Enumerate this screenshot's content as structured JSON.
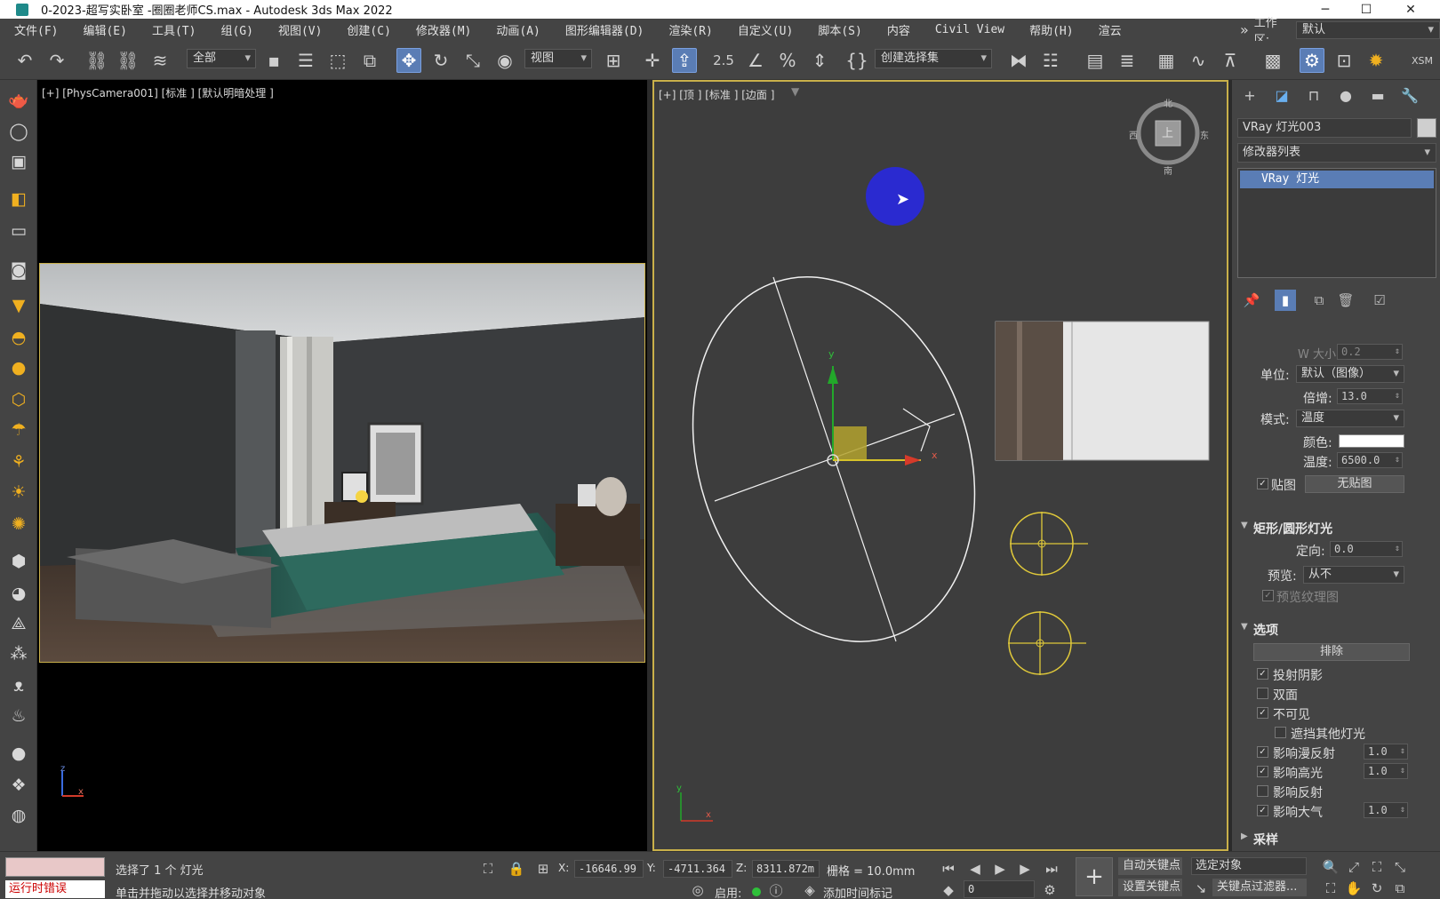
{
  "window": {
    "title": "0-2023-超写实卧室 -圈圈老师CS.max - Autodesk 3ds Max 2022",
    "minimize": "─",
    "maximize": "☐",
    "close": "✕"
  },
  "menu": {
    "items": [
      "文件(F)",
      "编辑(E)",
      "工具(T)",
      "组(G)",
      "视图(V)",
      "创建(C)",
      "修改器(M)",
      "动画(A)",
      "图形编辑器(D)",
      "渲染(R)",
      "自定义(U)",
      "脚本(S)",
      "内容",
      "Civil View",
      "帮助(H)",
      "渲云"
    ],
    "overflow": "»",
    "workspace_label": "工作区:",
    "workspace_value": "默认"
  },
  "toolbar": {
    "filter_dropdown": "全部",
    "ref_coord_dropdown": "视图",
    "selection_set_dropdown": "创建选择集",
    "snap_label": "2.5",
    "extra_label": "XSM"
  },
  "viewport_left": {
    "label": "[+] [PhysCamera001] [标准 ] [默认明暗处理 ]",
    "axis_z": "z",
    "axis_x": "x"
  },
  "viewport_right": {
    "label": "[+] [顶 ] [标准 ] [边面 ]",
    "viewcube": {
      "face": "上",
      "north": "北",
      "south": "南",
      "east": "东",
      "west": "西"
    },
    "gizmo_x": "x",
    "gizmo_y": "y",
    "axis_y": "y",
    "axis_x": "x"
  },
  "command_panel": {
    "object_name": "VRay 灯光003",
    "modifier_list": "修改器列表",
    "stack_item": "VRay 灯光",
    "params": {
      "w_size_label": "W 大小:",
      "w_size_value": "0.2",
      "unit_label": "单位:",
      "unit_value": "默认（图像）",
      "multiplier_label": "倍增:",
      "multiplier_value": "13.0",
      "mode_label": "模式:",
      "mode_value": "温度",
      "color_label": "颜色:",
      "temperature_label": "温度:",
      "temperature_value": "6500.0",
      "texture_label": "贴图",
      "no_texture_button": "无贴图"
    },
    "rect_section": {
      "title": "矩形/圆形灯光",
      "directional_label": "定向:",
      "directional_value": "0.0",
      "preview_label": "预览:",
      "preview_value": "从不",
      "preview_texture_label": "预览纹理图"
    },
    "options_section": {
      "title": "选项",
      "exclude_button": "排除",
      "cast_shadows": "投射阴影",
      "double_sided": "双面",
      "invisible": "不可见",
      "occlude_other": "遮挡其他灯光",
      "affect_diffuse": "影响漫反射",
      "affect_diffuse_value": "1.0",
      "affect_specular": "影响高光",
      "affect_specular_value": "1.0",
      "affect_reflections": "影响反射",
      "affect_atmosphere": "影响大气",
      "affect_atmosphere_value": "1.0"
    },
    "sampling_section": {
      "title": "采样"
    }
  },
  "status": {
    "error_label": "运行时错误",
    "selected_text": "选择了 1 个 灯光",
    "prompt_text": "单击并拖动以选择并移动对象",
    "x_label": "X:",
    "x_value": "-16646.99",
    "y_label": "Y:",
    "y_value": "-4711.364",
    "z_label": "Z:",
    "z_value": "8311.872m",
    "grid_text": "栅格 = 10.0mm",
    "enable_label": "启用:",
    "add_time_tag": "添加时间标记",
    "auto_key": "自动关键点",
    "selected_object": "选定对象",
    "set_key": "设置关键点",
    "key_filter": "关键点过滤器...",
    "frame_value": "0"
  }
}
